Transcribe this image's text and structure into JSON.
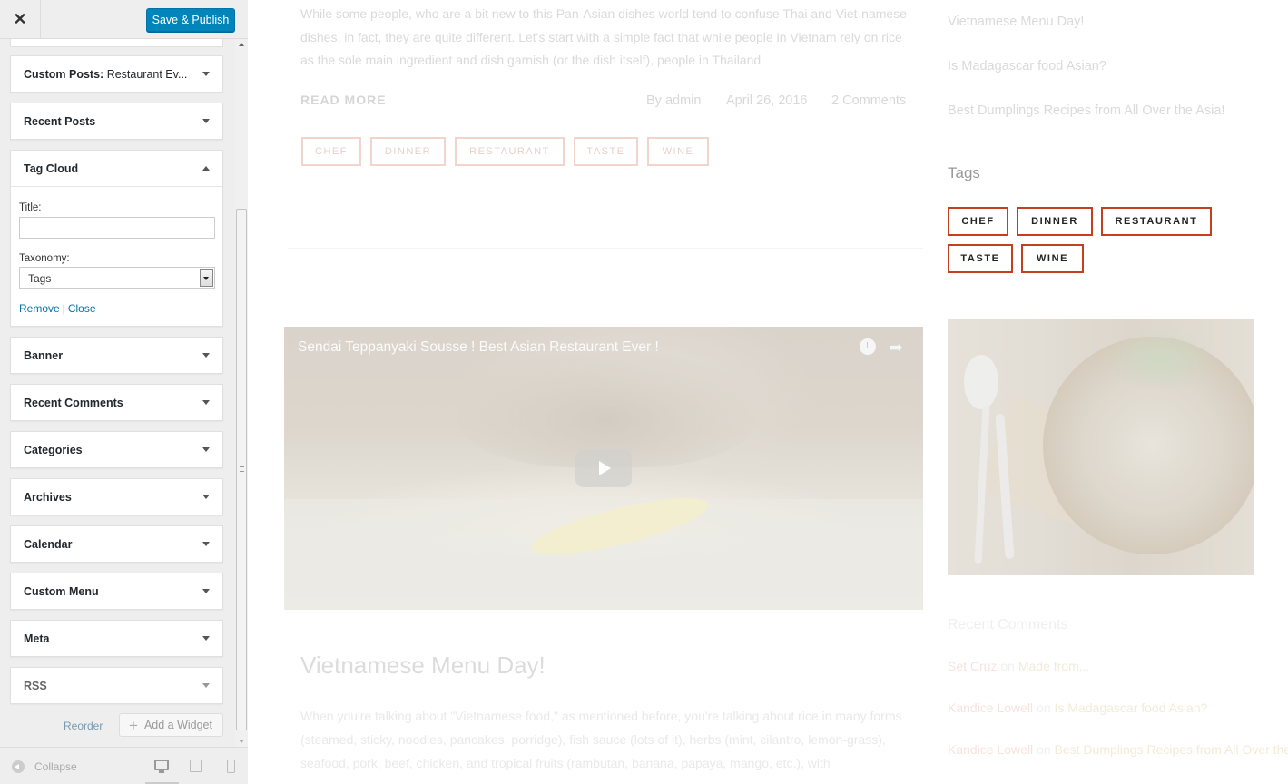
{
  "customizer": {
    "close_glyph": "✕",
    "save_label": "Save & Publish",
    "widgets": [
      {
        "title": "Custom Posts:",
        "subtitle": "Restaurant Ev..."
      },
      {
        "title": "Recent Posts"
      },
      {
        "title": "Tag Cloud",
        "expanded": true
      },
      {
        "title": "Banner"
      },
      {
        "title": "Recent Comments"
      },
      {
        "title": "Categories"
      },
      {
        "title": "Archives"
      },
      {
        "title": "Calendar"
      },
      {
        "title": "Custom Menu"
      },
      {
        "title": "Meta"
      },
      {
        "title": "RSS"
      }
    ],
    "tag_cloud_form": {
      "title_label": "Title:",
      "title_value": "",
      "taxonomy_label": "Taxonomy:",
      "taxonomy_value": "Tags",
      "remove_label": "Remove",
      "separator": "|",
      "close_label": "Close"
    },
    "reorder_label": "Reorder",
    "add_widget_label": "Add a Widget",
    "collapse_label": "Collapse",
    "active_device": "desktop"
  },
  "preview": {
    "excerpt": "While some people, who are a bit new to this Pan-Asian dishes world tend to confuse Thai and Viet-namese dishes, in fact, they are quite different. Let's start with a simple fact that while people in Vietnam rely on rice as the sole main ingredient and dish garnish (or the dish itself), people in Thailand",
    "read_more": "READ MORE",
    "meta": {
      "author": "By admin",
      "date": "April 26, 2016",
      "comments": "2 Comments"
    },
    "post_tags": [
      "CHEF",
      "DINNER",
      "RESTAURANT",
      "TASTE",
      "WINE"
    ],
    "video": {
      "title": "Sendai Teppanyaki Sousse ! Best Asian Restaurant Ever !"
    },
    "second_post": {
      "title": "Vietnamese Menu Day!",
      "text": "When you're talking about \"Vietnamese food,\" as mentioned before, you're talking about rice in many forms (steamed, sticky, noodles, pancakes, porridge), fish sauce (lots of it), herbs (mint, cilantro, lemon-grass), seafood, pork, beef, chicken, and tropical fruits (rambutan, banana, papaya, mango, etc.), with"
    },
    "sidebar": {
      "recent_posts": [
        "Vietnamese Menu Day!",
        "Is Madagascar food Asian?",
        "Best Dumplings Recipes from All Over the Asia!"
      ],
      "tags_heading": "Tags",
      "tags": [
        "CHEF",
        "DINNER",
        "RESTAURANT",
        "TASTE",
        "WINE"
      ],
      "recent_comments_heading": "Recent Comments",
      "recent_comments": [
        {
          "author": "Set Cruz",
          "on": " on ",
          "post": "Made from..."
        },
        {
          "author": "Kandice Lowell",
          "on": " on ",
          "post": "Is Madagascar food Asian?"
        },
        {
          "author": "Kandice Lowell",
          "on": " on ",
          "post": "Best Dumplings Recipes from All Over the Asia!"
        }
      ]
    }
  },
  "colors": {
    "accent_blue": "#0085ba",
    "tag_border": "#c2401f",
    "link_blue": "#0073aa"
  }
}
